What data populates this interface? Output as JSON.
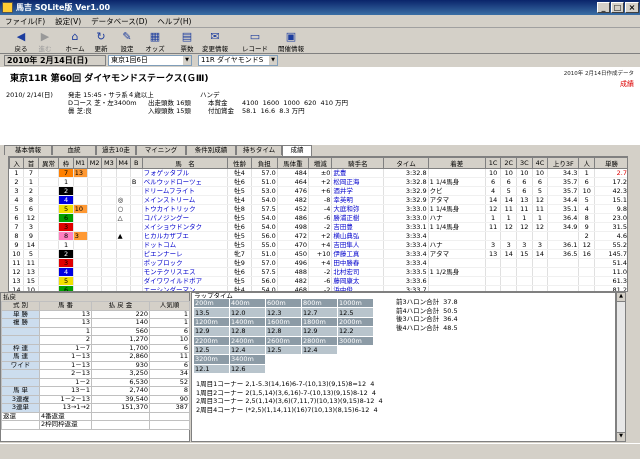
{
  "app": {
    "title": "馬吉 SQLite版 Ver1.00"
  },
  "menu": [
    "ファイル(F)",
    "設定(V)",
    "データベース(D)",
    "ヘルプ(H)"
  ],
  "toolbar": [
    {
      "label": "戻る",
      "icon": "back-arrow-icon",
      "glyph": "◀"
    },
    {
      "label": "進む",
      "icon": "forward-arrow-icon",
      "glyph": "▶"
    },
    {
      "label": "ホーム",
      "icon": "home-icon",
      "glyph": "⌂"
    },
    {
      "label": "更新",
      "icon": "refresh-icon",
      "glyph": "↻"
    },
    {
      "label": "設定",
      "icon": "settings-icon",
      "glyph": "✎"
    },
    {
      "label": "オッズ",
      "icon": "odds-icon",
      "glyph": "▦"
    },
    {
      "label": "票数",
      "icon": "votes-icon",
      "glyph": "▤"
    },
    {
      "label": "変更情報",
      "icon": "change-info-icon",
      "glyph": "✉"
    },
    {
      "label": "レコード",
      "icon": "record-icon",
      "glyph": "▭"
    },
    {
      "label": "開催情報",
      "icon": "schedule-icon",
      "glyph": "▣"
    }
  ],
  "selectors": {
    "date": "2010年 2月14日(日)",
    "venue": "東京1回6日",
    "race": "11R ダイヤモンドS"
  },
  "race": {
    "name": "東京11R 第60回 ダイヤモンドステークス(ＧⅢ)",
    "date_line": "2010/ 2/14(日)",
    "start": "発走 15:45・サラ系４歳以上",
    "course": "Dコース 芝・左3400m",
    "weather": "曇 芝:良",
    "condition": "ハンデ",
    "entries1": "出走頭数 16頭",
    "entries2": "入線頭数 15頭",
    "prize_label": "本賞金",
    "prize": "4100  1600  1000  620  410 万円",
    "add_label": "付加賞金",
    "add": "58.1  16.6  8.3 万円",
    "created": "2010年 2月14日作成データ",
    "status": "成績"
  },
  "tabs": [
    "基本情報",
    "血統",
    "過去10走",
    "マイニング",
    "条件別成績",
    "持ちタイム",
    "成績"
  ],
  "grid": {
    "headers": [
      "入",
      "首",
      "異常",
      "枠",
      "M1",
      "M2",
      "M3",
      "M4",
      "B",
      "馬　名",
      "性齢",
      "負担",
      "馬体重",
      "増減",
      "騎手名",
      "タイム",
      "着差",
      "1C",
      "2C",
      "3C",
      "4C",
      "上り3F",
      "人",
      "単勝"
    ],
    "rows": [
      [
        "1",
        "7",
        "",
        "7",
        "13",
        "",
        "",
        "",
        "",
        "フォゲッタブル",
        "牡4",
        "57.0",
        "484",
        "±0",
        "武豊",
        "3:32.8",
        "",
        "10",
        "10",
        "10",
        "10",
        "34.3",
        "1",
        "2.7"
      ],
      [
        "2",
        "1",
        "",
        "1",
        "",
        "",
        "",
        "",
        "B",
        "ベルウッドローツェ",
        "牡6",
        "51.0",
        "464",
        "+2",
        "松岡正海",
        "3:32.8",
        "1 1/4馬身",
        "6",
        "6",
        "6",
        "6",
        "35.7",
        "6",
        "17.2"
      ],
      [
        "3",
        "2",
        "",
        "2",
        "",
        "",
        "",
        "",
        "",
        "ドリームフライト",
        "牡5",
        "53.0",
        "476",
        "+6",
        "酒井学",
        "3:32.9",
        "クビ",
        "4",
        "5",
        "6",
        "5",
        "35.7",
        "10",
        "42.3"
      ],
      [
        "4",
        "8",
        "",
        "4",
        "",
        "",
        "",
        "◎",
        "",
        "メインストリーム",
        "牡4",
        "54.0",
        "482",
        "-8",
        "幸英明",
        "3:32.9",
        "アタマ",
        "14",
        "14",
        "13",
        "12",
        "34.4",
        "5",
        "15.1"
      ],
      [
        "5",
        "6",
        "",
        "5",
        "10",
        "",
        "",
        "○",
        "",
        "トウカイトリック",
        "牡8",
        "57.5",
        "452",
        "-4",
        "大庭和弥",
        "3:33.0",
        "1 1/4馬身",
        "12",
        "11",
        "11",
        "11",
        "35.1",
        "4",
        "9.8"
      ],
      [
        "6",
        "12",
        "",
        "6",
        "",
        "",
        "",
        "△",
        "",
        "コパノジングー",
        "牡5",
        "54.0",
        "486",
        "-6",
        "勝浦正樹",
        "3:33.0",
        "ハナ",
        "1",
        "1",
        "1",
        "1",
        "36.4",
        "8",
        "23.0"
      ],
      [
        "7",
        "3",
        "",
        "3",
        "",
        "",
        "",
        "",
        "",
        "メイショウドンタク",
        "牡6",
        "54.0",
        "498",
        "-2",
        "吉田豊",
        "3:33.1",
        "1 1/4馬身",
        "11",
        "12",
        "12",
        "12",
        "34.9",
        "9",
        "31.5"
      ],
      [
        "8",
        "9",
        "",
        "8",
        "3",
        "",
        "",
        "▲",
        "",
        "ヒカルカザブエ",
        "牡5",
        "56.0",
        "472",
        "+2",
        "横山典弘",
        "3:33.4",
        "",
        "",
        "",
        "",
        "",
        "",
        "2",
        "4.6"
      ],
      [
        "9",
        "14",
        "",
        "1",
        "",
        "",
        "",
        "",
        "",
        "ドットコム",
        "牡5",
        "55.0",
        "470",
        "+4",
        "吉田隼人",
        "3:33.4",
        "ハナ",
        "3",
        "3",
        "3",
        "3",
        "36.1",
        "12",
        "55.2"
      ],
      [
        "10",
        "5",
        "",
        "2",
        "",
        "",
        "",
        "",
        "",
        "ピエンナーレ",
        "牝7",
        "51.0",
        "450",
        "+10",
        "伊藤工真",
        "3:33.4",
        "アタマ",
        "13",
        "14",
        "15",
        "14",
        "36.5",
        "16",
        "145.7"
      ],
      [
        "11",
        "11",
        "",
        "3",
        "",
        "",
        "",
        "",
        "",
        "ポップロック",
        "牡9",
        "57.0",
        "496",
        "+4",
        "田中勝春",
        "3:33.4",
        "",
        "",
        "",
        "",
        "",
        "",
        "",
        "51.4"
      ],
      [
        "12",
        "13",
        "",
        "4",
        "",
        "",
        "",
        "",
        "",
        "モンテクリスエス",
        "牡6",
        "57.5",
        "488",
        "-2",
        "北村宏司",
        "3:33.5",
        "1 1/2馬身",
        "",
        "",
        "",
        "",
        "",
        "",
        "11.0"
      ],
      [
        "13",
        "15",
        "",
        "5",
        "",
        "",
        "",
        "",
        "",
        "ダイワワイルドボア",
        "牡5",
        "56.0",
        "482",
        "-6",
        "藤岡康太",
        "3:33.6",
        "",
        "",
        "",
        "",
        "",
        "",
        "",
        "61.3"
      ],
      [
        "14",
        "10",
        "",
        "6",
        "",
        "",
        "",
        "",
        "",
        "エーシンダーマン",
        "牡4",
        "54.0",
        "468",
        "-2",
        "浜中俊",
        "3:33.7",
        "",
        "",
        "",
        "",
        "",
        "",
        "",
        "81.2"
      ],
      [
        "15",
        "16",
        "",
        "7",
        "",
        "",
        "",
        "",
        "",
        "ハーマジェスティ",
        "牡5",
        "52.0",
        "456",
        "0",
        "小林慎一",
        "3:33.9",
        "",
        "",
        "",
        "",
        "",
        "",
        "",
        "5.4"
      ],
      [
        "取消",
        "4",
        "",
        "8",
        "",
        "",
        "",
        "",
        "",
        "ジャガーメイル",
        "牡6",
        "56.0",
        "",
        "",
        "ルメール",
        "",
        "",
        "",
        "",
        "",
        "",
        "",
        "",
        ""
      ]
    ]
  },
  "payout": {
    "title": "払戻",
    "headers": [
      "式 別",
      "馬 番",
      "払 戻 金",
      "人気順"
    ],
    "rows": [
      [
        "単 勝",
        "13",
        "220",
        "1"
      ],
      [
        "複 勝",
        "13",
        "140",
        "1"
      ],
      [
        "",
        "1",
        "560",
        "6"
      ],
      [
        "",
        "2",
        "1,270",
        "10"
      ],
      [
        "枠 連",
        "1－7",
        "1,700",
        "6"
      ],
      [
        "馬 連",
        "1－13",
        "2,860",
        "11"
      ],
      [
        "ワイド",
        "1－13",
        "930",
        "6"
      ],
      [
        "",
        "2－13",
        "3,250",
        "34"
      ],
      [
        "",
        "1－2",
        "6,530",
        "52"
      ],
      [
        "馬 単",
        "13－1",
        "2,740",
        "8"
      ],
      [
        "3連複",
        "1－2－13",
        "39,540",
        "90"
      ],
      [
        "3連単",
        "13→1→2",
        "151,370",
        "387"
      ],
      [
        "返還",
        "4番返還",
        "",
        ""
      ],
      [
        "",
        "2枠同枠返還",
        "",
        ""
      ]
    ]
  },
  "laptime": {
    "title": "ラップタイム",
    "grid": [
      [
        "200m",
        "400m",
        "600m",
        "800m",
        "1000m"
      ],
      [
        "13.5",
        "12.0",
        "12.3",
        "12.7",
        "12.5"
      ],
      [
        "1200m",
        "1400m",
        "1600m",
        "1800m",
        "2000m"
      ],
      [
        "12.9",
        "12.8",
        "12.8",
        "12.9",
        "12.2"
      ],
      [
        "2200m",
        "2400m",
        "2600m",
        "2800m",
        "3000m"
      ],
      [
        "12.5",
        "12.4",
        "12.5",
        "12.4",
        ""
      ],
      [
        "3200m",
        "3400m",
        "",
        "",
        ""
      ],
      [
        "12.1",
        "12.6",
        "",
        "",
        ""
      ]
    ],
    "furlongs": [
      [
        "前3ハロン合計",
        "37.8"
      ],
      [
        "前4ハロン合計",
        "50.5"
      ],
      [
        "後3ハロン合計",
        "36.4"
      ],
      [
        "後4ハロン合計",
        "48.5"
      ]
    ],
    "corners": [
      "1周目1コーナー 2,1-5.3(14,16)6-7-(10,13)(9,15)8=12  4",
      "1周目2コーナー 2(1,5,14)(3,6,16)-7-(10,13)(9,15)8-12  4",
      "2周目3コーナー 2,5(1,14)(3,6)(7,11,7)(10,13)(9,15)8-12  4",
      "2周目4コーナー (*2,5)(1,14,11)(16)7(10,13)(8,15)6-12  4"
    ]
  },
  "colors": {
    "accent": "#0a246a",
    "frame": [
      "#ffffff",
      "#000000",
      "#e00000",
      "#0000e0",
      "#f0e000",
      "#00a000",
      "#ff8000",
      "#ff80c0"
    ]
  }
}
